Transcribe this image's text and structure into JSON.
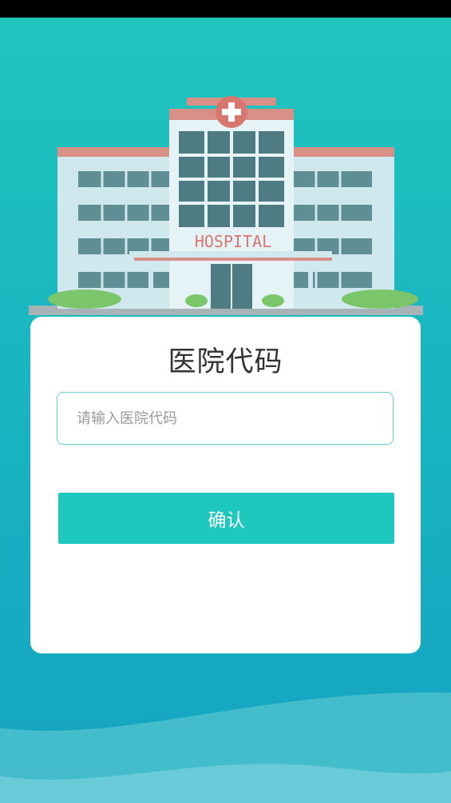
{
  "card": {
    "title": "医院代码",
    "input_placeholder": "请输入医院代码",
    "input_value": "",
    "confirm_label": "确认"
  },
  "illustration": {
    "sign_text": "HOSPITAL",
    "icon": "hospital-building-icon"
  },
  "colors": {
    "background_top": "#1fc6bd",
    "background_bottom": "#15a3c3",
    "accent": "#1ec8bd",
    "input_border": "#5fd3cf",
    "title_text": "#333333",
    "placeholder_text": "#9a9a9a"
  }
}
